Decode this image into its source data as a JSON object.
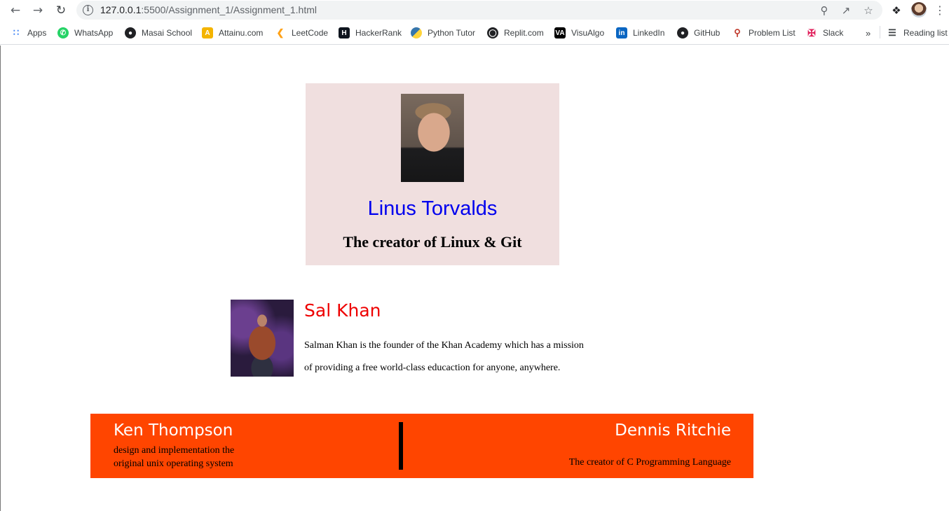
{
  "browser": {
    "url_host": "127.0.0.1",
    "url_rest": ":5500/Assignment_1/Assignment_1.html",
    "bookmarks": [
      {
        "label": "Apps",
        "icon": "apps-grid-icon",
        "color": "#4285f4"
      },
      {
        "label": "WhatsApp",
        "icon": "whatsapp-icon",
        "color": "#25d366"
      },
      {
        "label": "Masai School",
        "icon": "globe-icon",
        "color": "#202124"
      },
      {
        "label": "Attainu.com",
        "icon": "attainu-icon",
        "color": "#f4b400"
      },
      {
        "label": "LeetCode",
        "icon": "leetcode-icon",
        "color": "#ffa116"
      },
      {
        "label": "HackerRank",
        "icon": "hackerrank-icon",
        "color": "#1ba94c"
      },
      {
        "label": "Python Tutor",
        "icon": "python-icon",
        "color": "#3776ab"
      },
      {
        "label": "Replit.com",
        "icon": "replit-icon",
        "color": "#202124"
      },
      {
        "label": "VisuAlgo",
        "icon": "visualgo-icon",
        "color": "#000000"
      },
      {
        "label": "LinkedIn",
        "icon": "linkedin-icon",
        "color": "#0a66c2"
      },
      {
        "label": "GitHub",
        "icon": "github-icon",
        "color": "#202124"
      },
      {
        "label": "Problem List",
        "icon": "pin-icon",
        "color": "#c0392b"
      },
      {
        "label": "Slack",
        "icon": "slack-icon",
        "color": "#e01e5a"
      }
    ],
    "overflow_label": "»",
    "reading_list_label": "Reading list"
  },
  "linus": {
    "name": "Linus Torvalds",
    "subtitle": "The creator of Linux & Git"
  },
  "sal": {
    "name": "Sal Khan",
    "line1": "Salman Khan is the founder of the Khan Academy which has a mission",
    "line2": "of providing a free world-class educaction for anyone, anywhere."
  },
  "footer": {
    "ken_name": "Ken Thompson",
    "ken_line1": "design and implementation the",
    "ken_line2": "original unix operating system",
    "dennis_name": "Dennis Ritchie",
    "dennis_desc": "The creator of C Programming Language",
    "band_color": "#ff4500"
  }
}
